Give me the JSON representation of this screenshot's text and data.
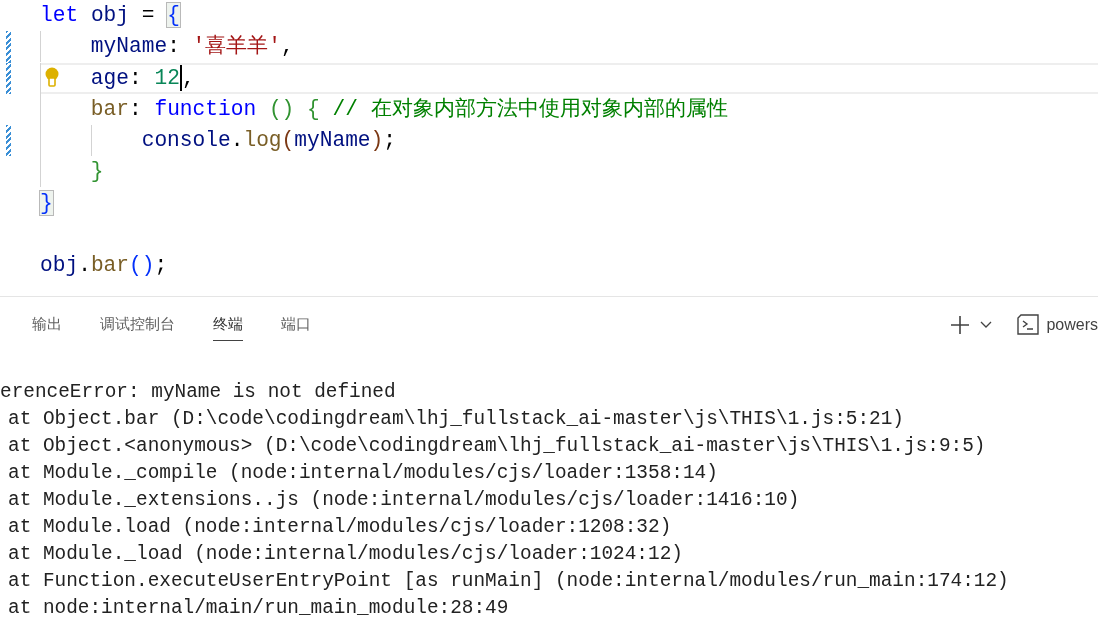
{
  "editor": {
    "lines": [
      {
        "modified": false,
        "current": false,
        "lightbulb": false,
        "tokens": [
          {
            "kind": "kw",
            "text": "let"
          },
          {
            "kind": "var",
            "text": " obj"
          },
          {
            "kind": "punct",
            "text": " = "
          },
          {
            "kind": "match",
            "text": "{"
          }
        ]
      },
      {
        "modified": true,
        "current": false,
        "lightbulb": false,
        "tokens": [
          {
            "kind": "prop",
            "text": "    myName"
          },
          {
            "kind": "punct",
            "text": ": "
          },
          {
            "kind": "str",
            "text": "'喜羊羊'"
          },
          {
            "kind": "punct",
            "text": ","
          }
        ]
      },
      {
        "modified": true,
        "current": true,
        "lightbulb": true,
        "tokens": [
          {
            "kind": "prop",
            "text": "    age"
          },
          {
            "kind": "punct",
            "text": ": "
          },
          {
            "kind": "num",
            "text": "12",
            "cursor_after": true
          },
          {
            "kind": "punct",
            "text": ","
          }
        ]
      },
      {
        "modified": false,
        "current": false,
        "lightbulb": false,
        "tokens": [
          {
            "kind": "fn",
            "text": "    bar"
          },
          {
            "kind": "punct",
            "text": ": "
          },
          {
            "kind": "kw",
            "text": "function"
          },
          {
            "kind": "b2",
            "text": " () {"
          },
          {
            "kind": "comment",
            "text": " // 在对象内部方法中使用对象内部的属性"
          }
        ]
      },
      {
        "modified": true,
        "current": false,
        "lightbulb": false,
        "tokens": [
          {
            "kind": "var",
            "text": "        console"
          },
          {
            "kind": "punct",
            "text": "."
          },
          {
            "kind": "fn",
            "text": "log"
          },
          {
            "kind": "b3",
            "text": "("
          },
          {
            "kind": "var",
            "text": "myName"
          },
          {
            "kind": "b3",
            "text": ")"
          },
          {
            "kind": "punct",
            "text": ";"
          }
        ]
      },
      {
        "modified": false,
        "current": false,
        "lightbulb": false,
        "tokens": [
          {
            "kind": "b2",
            "text": "    }"
          }
        ]
      },
      {
        "modified": false,
        "current": false,
        "lightbulb": false,
        "tokens": [
          {
            "kind": "match",
            "text": "}"
          }
        ]
      },
      {
        "modified": false,
        "current": false,
        "lightbulb": false
      },
      {
        "modified": false,
        "current": false,
        "lightbulb": false,
        "tokens": [
          {
            "kind": "var",
            "text": "obj"
          },
          {
            "kind": "punct",
            "text": "."
          },
          {
            "kind": "fn",
            "text": "bar"
          },
          {
            "kind": "b1",
            "text": "()"
          },
          {
            "kind": "punct",
            "text": ";"
          }
        ]
      }
    ]
  },
  "panel": {
    "tabs": [
      {
        "label": "输出",
        "selected": false
      },
      {
        "label": "调试控制台",
        "selected": false
      },
      {
        "label": "终端",
        "selected": true
      },
      {
        "label": "端口",
        "selected": false
      }
    ],
    "shell_label": "powers"
  },
  "terminal": {
    "lines": [
      {
        "kind": "message",
        "text": "erenceError: myName is not defined"
      },
      {
        "kind": "frame",
        "text": "at Object.bar (D:\\code\\codingdream\\lhj_fullstack_ai-master\\js\\THIS\\1.js:5:21)"
      },
      {
        "kind": "frame",
        "text": "at Object.<anonymous> (D:\\code\\codingdream\\lhj_fullstack_ai-master\\js\\THIS\\1.js:9:5)"
      },
      {
        "kind": "frame",
        "text": "at Module._compile (node:internal/modules/cjs/loader:1358:14)"
      },
      {
        "kind": "frame",
        "text": "at Module._extensions..js (node:internal/modules/cjs/loader:1416:10)"
      },
      {
        "kind": "frame",
        "text": "at Module.load (node:internal/modules/cjs/loader:1208:32)"
      },
      {
        "kind": "frame",
        "text": "at Module._load (node:internal/modules/cjs/loader:1024:12)"
      },
      {
        "kind": "frame",
        "text": "at Function.executeUserEntryPoint [as runMain] (node:internal/modules/run_main:174:12)"
      },
      {
        "kind": "frame",
        "text": "at node:internal/main/run_main_module:28:49"
      }
    ]
  }
}
